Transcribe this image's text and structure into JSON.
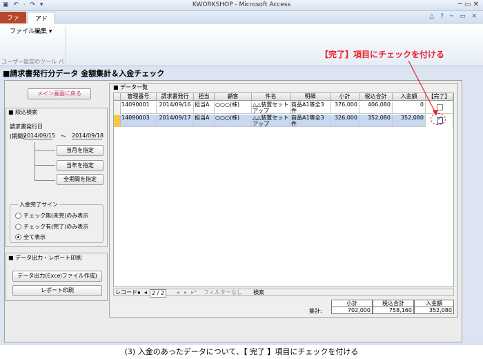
{
  "window": {
    "title": "KWORKSHOP - Microsoft Access",
    "quick_access": "▣ ↶ · ↷ ▾",
    "controls": "─ ▭ ✕"
  },
  "ribbon": {
    "tabs": [
      "ファイル",
      "アドイン"
    ],
    "menus": [
      "ファイル ▾",
      "編集 ▾"
    ],
    "group_label": "ユーザー設定のツール バー",
    "right_controls": "△ ? ─ ▭ ✕"
  },
  "annotation": {
    "text": "【完了】項目にチェックを付ける",
    "color": "#e8202a"
  },
  "form": {
    "title": "■請求書発行分データ 金額集計＆入金チェック",
    "menu_button": "メイン画面に戻る",
    "search": {
      "title": "■ 絞込検索",
      "label_date": "請求書発行日",
      "label_period": "(期間):",
      "from": "2014/09/15",
      "tilde": "～",
      "to": "2014/09/18",
      "btn_month": "当月を指定",
      "btn_year": "当年を指定",
      "btn_all": "全期間を指定"
    },
    "flag": {
      "title": "入金完了サイン",
      "options": [
        "チェック無(未完)のみ表示",
        "チェック有(完了)のみ表示",
        "全て表示"
      ],
      "selected": 2
    },
    "output": {
      "title": "■ データ出力・レポート印刷",
      "btn_excel": "データ出力(Excelファイル作成)",
      "btn_report": "レポート印刷"
    },
    "data": {
      "title": "■ データ一覧",
      "headers": [
        "管理番号",
        "請求書発行",
        "担当",
        "顧客",
        "件名",
        "明細",
        "小計",
        "税込合計",
        "入金額",
        "【完了】"
      ],
      "rows": [
        {
          "id": "14090001",
          "date": "2014/09/16",
          "staff": "担当A",
          "customer": "○○○(株)",
          "subject": "△△装置セットアップ",
          "detail": "商品A1等全3件",
          "subtotal": "376,000",
          "total": "406,080",
          "paid": "0",
          "done": false
        },
        {
          "id": "14090003",
          "date": "2014/09/17",
          "staff": "担当A",
          "customer": "○○○(株)",
          "subject": "△△装置セットアップ",
          "detail": "商品A1等全3件",
          "subtotal": "326,000",
          "total": "352,080",
          "paid": "352,080",
          "done": true
        }
      ]
    },
    "nav": {
      "record_label": "レコード:",
      "first": "◂",
      "prev": "◂",
      "position": "2 / 2",
      "next": "▸",
      "last": "▸",
      "new": "▸*",
      "filter": "フィルターなし",
      "search": "検索"
    },
    "totals": {
      "label": "集計:",
      "headers": [
        "小計",
        "税込合計",
        "入金額"
      ],
      "values": [
        "702,000",
        "758,160",
        "352,080"
      ]
    }
  },
  "caption": "(3) 入金のあったデータについて、【 完了 】項目にチェックを付ける"
}
